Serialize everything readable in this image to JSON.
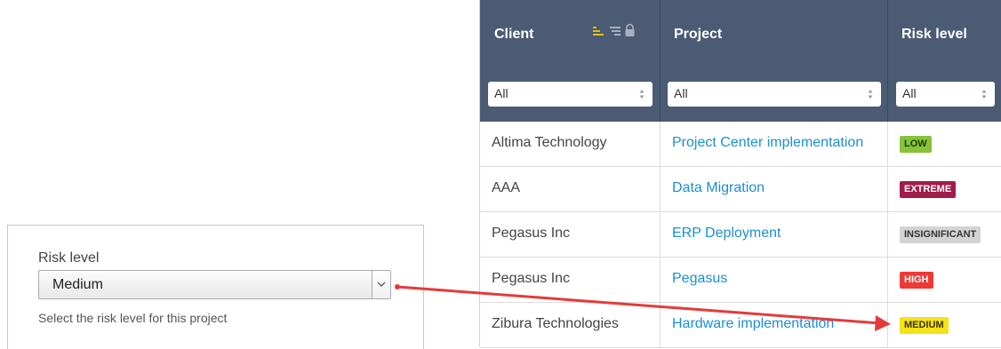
{
  "form": {
    "label": "Risk level",
    "value": "Medium",
    "help": "Select the risk level for this project"
  },
  "table": {
    "columns": [
      {
        "title": "Client",
        "filter": "All"
      },
      {
        "title": "Project",
        "filter": "All"
      },
      {
        "title": "Risk level",
        "filter": "All"
      }
    ],
    "rows": [
      {
        "client": "Altima Technology",
        "project": "Project Center implementation",
        "risk": "LOW"
      },
      {
        "client": "AAA",
        "project": "Data Migration",
        "risk": "EXTREME"
      },
      {
        "client": "Pegasus Inc",
        "project": "ERP Deployment",
        "risk": "INSIGNIFICANT"
      },
      {
        "client": "Pegasus Inc",
        "project": "Pegasus",
        "risk": "HIGH"
      },
      {
        "client": "Zibura Technologies",
        "project": "Hardware implementation",
        "risk": "MEDIUM"
      }
    ]
  },
  "icons": {
    "sort_ascending": "sort-ascending-icon",
    "sort_descending": "sort-descending-icon",
    "lock": "lock-icon",
    "dropdown": "chevron-down-icon"
  },
  "colors": {
    "header_bg": "#4b5b73",
    "link": "#1b8fd0",
    "accent_icon": "#e6c200",
    "low": "#86c33a",
    "extreme": "#a01d47",
    "insignificant": "#d3d3d3",
    "high": "#ee3a36",
    "medium": "#f5e218",
    "arrow": "#e53a3a"
  }
}
